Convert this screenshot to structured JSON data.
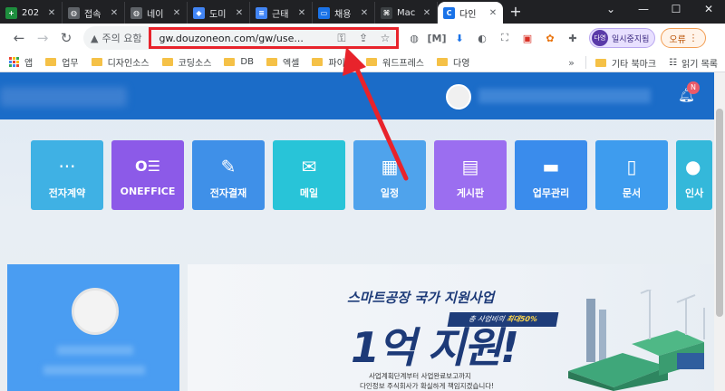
{
  "tabs": [
    {
      "title": "202",
      "color": "#1e8e3e",
      "glyph": "+"
    },
    {
      "title": "접속",
      "color": "#5f6368",
      "glyph": "◍"
    },
    {
      "title": "네이",
      "color": "#5f6368",
      "glyph": "◍"
    },
    {
      "title": "도미",
      "color": "#4285f4",
      "glyph": "◆"
    },
    {
      "title": "근태",
      "color": "#4285f4",
      "glyph": "≡"
    },
    {
      "title": "채용",
      "color": "#1a73e8",
      "glyph": "▭"
    },
    {
      "title": "Mac",
      "color": "#3c4043",
      "glyph": "⌘"
    },
    {
      "title": "다인",
      "color": "#1a73e8",
      "glyph": "C",
      "active": true
    }
  ],
  "toolbar": {
    "security_label": "주의 요함",
    "url": "gw.douzoneon.com/gw/use...",
    "profile_avatar": "다영",
    "profile_label": "일시중지됨",
    "error_label": "오류"
  },
  "bookmarks": {
    "apps_label": "앱",
    "items": [
      "업무",
      "디자인소스",
      "코딩소스",
      "DB",
      "엑셀",
      "파이썬",
      "워드프레스",
      "다영"
    ],
    "other_label": "기타 북마크",
    "reading_label": "읽기 목록"
  },
  "header": {
    "badge": "N"
  },
  "tiles": [
    {
      "label": "전자계약",
      "color": "#3fb1e4",
      "icon": "···"
    },
    {
      "label": "ONEFFICE",
      "color": "#8c5ae8",
      "icon": "O☰"
    },
    {
      "label": "전자결재",
      "color": "#3f90e8",
      "icon": "✎"
    },
    {
      "label": "메일",
      "color": "#28c4d8",
      "icon": "✉"
    },
    {
      "label": "일정",
      "color": "#4fa3ec",
      "icon": "▦"
    },
    {
      "label": "게시판",
      "color": "#9b6ef0",
      "icon": "▤"
    },
    {
      "label": "업무관리",
      "color": "#3a8cec",
      "icon": "▬"
    },
    {
      "label": "문서",
      "color": "#3e9cee",
      "icon": "▯"
    },
    {
      "label": "인사",
      "color": "#34b8da",
      "icon": "●"
    }
  ],
  "banner": {
    "title_a": "스마트공장",
    "title_b": " 국가 지원사업",
    "tag_a": "총 사업비의 ",
    "tag_b": "최대50%",
    "big": "1억 지원!",
    "sub1": "사업계획단계부터 사업완료보고까지",
    "sub2": "다인정보 주식회사가 확실하게 책임지겠습니다!"
  }
}
